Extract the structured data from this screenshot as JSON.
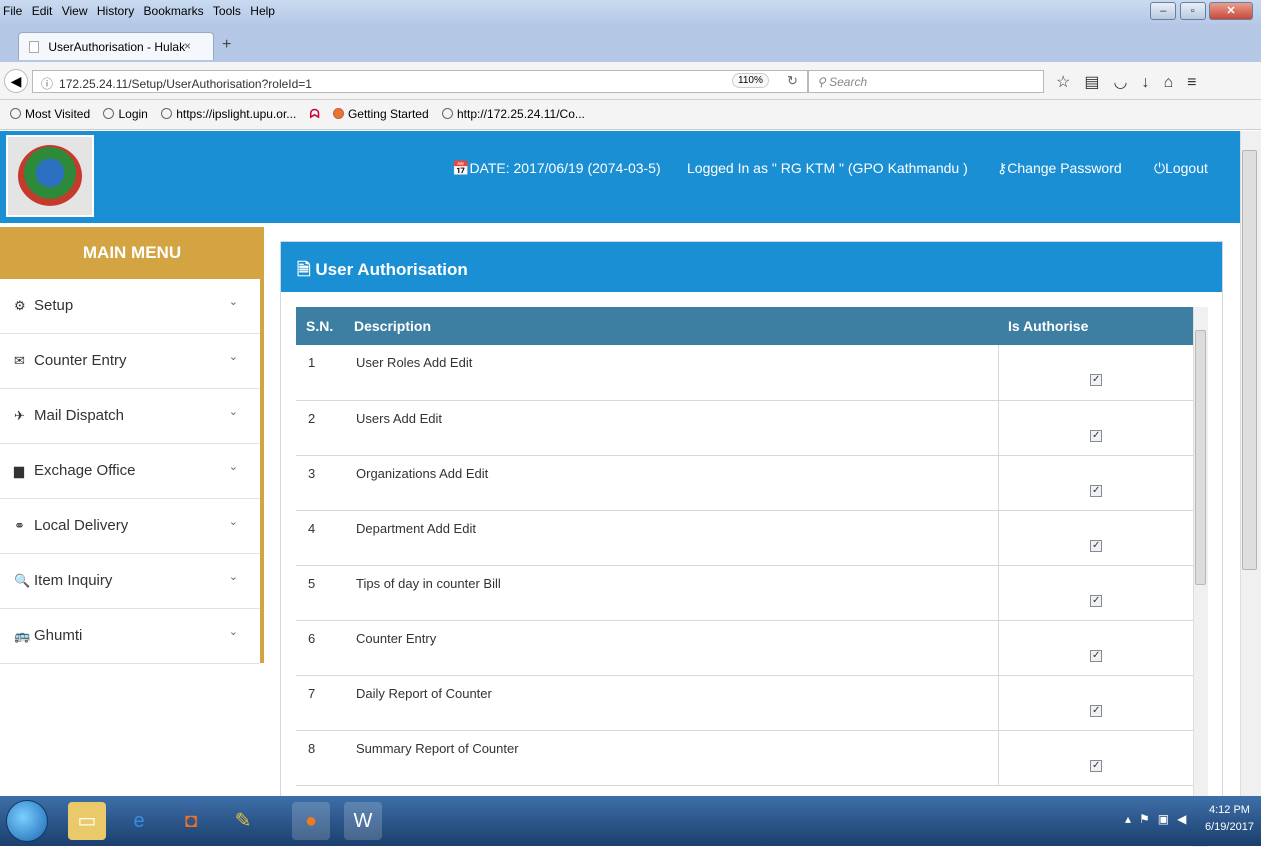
{
  "browser": {
    "menu": [
      "File",
      "Edit",
      "View",
      "History",
      "Bookmarks",
      "Tools",
      "Help"
    ],
    "tab_title": "UserAuthorisation - Hulak",
    "tab_close": "×",
    "new_tab": "+",
    "url": "172.25.24.11/Setup/UserAuthorisation?roleId=1",
    "zoom": "110%",
    "search_placeholder": "Search",
    "bookmarks": [
      "Most Visited",
      "Login",
      "https://ipslight.upu.or...",
      "Getting Started",
      "http://172.25.24.11/Co..."
    ]
  },
  "header": {
    "date": "DATE: 2017/06/19 (2074-03-5)",
    "logged_in": "Logged In as \" RG KTM \" (GPO Kathmandu )",
    "change_password": "Change Password",
    "logout": "Logout"
  },
  "sidebar": {
    "title": "MAIN MENU",
    "items": [
      {
        "label": "Setup",
        "icon": "gears-icon"
      },
      {
        "label": "Counter Entry",
        "icon": "envelope-icon"
      },
      {
        "label": "Mail Dispatch",
        "icon": "plane-icon"
      },
      {
        "label": "Exchage Office",
        "icon": "building-icon"
      },
      {
        "label": "Local Delivery",
        "icon": "bicycle-icon"
      },
      {
        "label": "Item Inquiry",
        "icon": "search-icon"
      },
      {
        "label": "Ghumti",
        "icon": "bus-icon"
      }
    ]
  },
  "panel": {
    "title": "User Authorisation",
    "columns": [
      "S.N.",
      "Description",
      "Is Authorise"
    ],
    "rows": [
      {
        "sn": "1",
        "desc": "User Roles Add Edit",
        "checked": true
      },
      {
        "sn": "2",
        "desc": "Users Add Edit",
        "checked": true
      },
      {
        "sn": "3",
        "desc": "Organizations Add Edit",
        "checked": true
      },
      {
        "sn": "4",
        "desc": "Department Add Edit",
        "checked": true
      },
      {
        "sn": "5",
        "desc": "Tips of day in counter Bill",
        "checked": true
      },
      {
        "sn": "6",
        "desc": "Counter Entry",
        "checked": true
      },
      {
        "sn": "7",
        "desc": "Daily Report of Counter",
        "checked": true
      },
      {
        "sn": "8",
        "desc": "Summary Report of Counter",
        "checked": true
      }
    ]
  },
  "taskbar": {
    "time": "4:12 PM",
    "date": "6/19/2017"
  },
  "colors": {
    "header_blue": "#1a8fd4",
    "menu_gold": "#d4a342",
    "table_head": "#3d7fa3"
  }
}
